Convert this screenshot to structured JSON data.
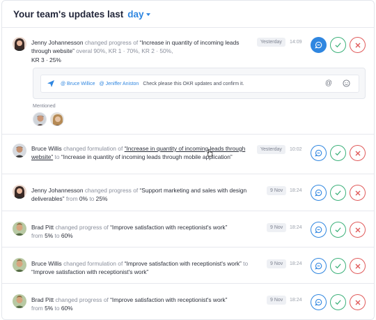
{
  "header": {
    "title": "Your team's updates last",
    "period": "day"
  },
  "rows": [
    {
      "name": "Jenny Johannesson",
      "verb": "changed progress of",
      "quote": "“Increase in quantity of incoming leads through website”",
      "details_line": "overal 90%, KR 1 · 70%, KR 2 · 50%,",
      "details_line2": "KR 3 · 25%",
      "date": "Yesterday",
      "time": "14:09"
    },
    {
      "name": "Bruce Willis",
      "verb": "changed formulation of",
      "quote_old": "“Increase in quantity of incoming leads through website”",
      "to": "to",
      "quote_new": "“Increase in quantity of incoming leads through mobile application”",
      "date": "Yesterday",
      "time": "10:02"
    },
    {
      "name": "Jenny Johannesson",
      "verb": "changed progress of",
      "quote": "“Support marketing and sales with design deliverables”",
      "from": "from",
      "from_val": "0%",
      "to": "to",
      "to_val": "25%",
      "date": "9 Nov",
      "time": "18:24"
    },
    {
      "name": "Brad Pitt",
      "verb": "changed progress of",
      "quote": "“Improve satisfaction with receptionist's work”",
      "from": "from",
      "from_val": "5%",
      "to": "to",
      "to_val": "60%",
      "date": "9 Nov",
      "time": "18:24"
    },
    {
      "name": "Bruce Willis",
      "verb": "changed formulation of",
      "quote_old": "“Improve satisfaction with receptionist's work”",
      "to": "to",
      "quote_new": "“Improve satisfaction with receptionist's work”",
      "date": "9 Nov",
      "time": "18:24"
    },
    {
      "name": "Brad Pitt",
      "verb": "changed progress of",
      "quote": "“Improve satisfaction with receptionist's work”",
      "from": "from",
      "from_val": "5%",
      "to": "to",
      "to_val": "60%",
      "date": "9 Nov",
      "time": "18:24"
    }
  ],
  "composer": {
    "mention1": "@ Bruce Willice",
    "mention2": "@ Jeniffer Aniston",
    "text": "Check please this OKR updates and confirm it."
  },
  "mentioned_label": "Mentioned",
  "icons": {
    "comment": "comment-icon",
    "confirm": "check-icon",
    "reject": "close-icon",
    "send": "send-icon",
    "at": "at-icon",
    "emoji": "emoji-icon"
  },
  "colors": {
    "accent": "#2f86e0",
    "confirm": "#3bb079",
    "reject": "#e05a5a"
  }
}
